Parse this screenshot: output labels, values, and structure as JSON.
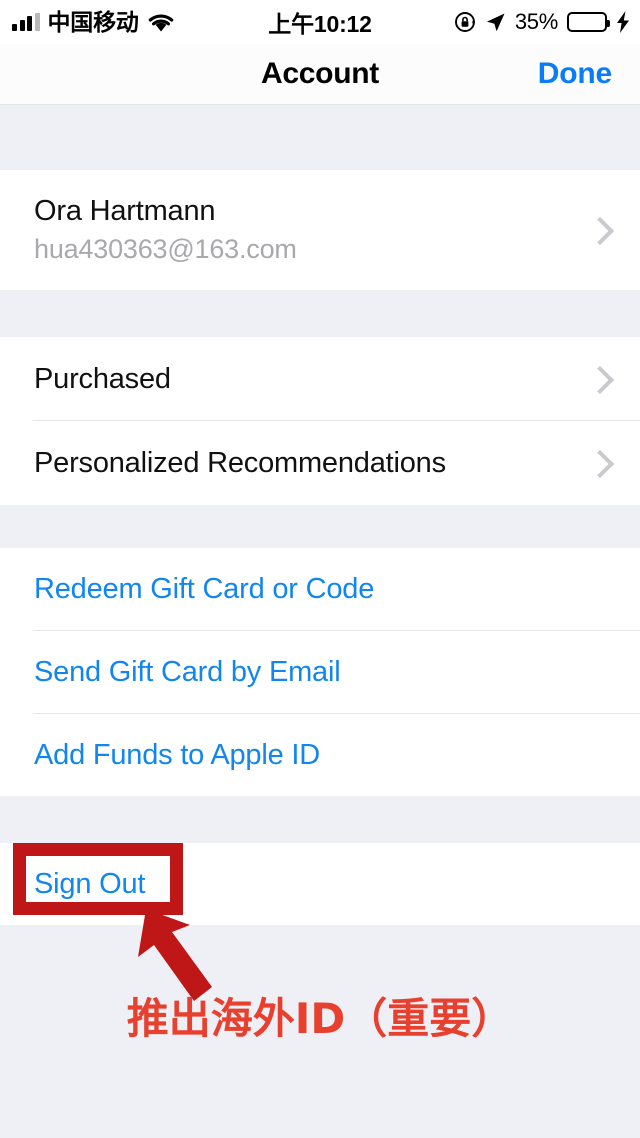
{
  "status_bar": {
    "carrier": "中国移动",
    "time": "上午10:12",
    "battery_percent": "35%",
    "battery_level": 35,
    "icons": {
      "signal": "signal-bars-icon",
      "wifi": "wifi-icon",
      "rotation_lock": "rotation-lock-icon",
      "location": "location-arrow-icon",
      "charging": "lightning-bolt-icon"
    }
  },
  "nav": {
    "title": "Account",
    "done_label": "Done"
  },
  "account": {
    "name": "Ora Hartmann",
    "email": "hua430363@163.com"
  },
  "sections": {
    "media": [
      {
        "label": "Purchased"
      },
      {
        "label": "Personalized Recommendations"
      }
    ],
    "gift": [
      {
        "label": "Redeem Gift Card or Code"
      },
      {
        "label": "Send Gift Card by Email"
      },
      {
        "label": "Add Funds to Apple ID"
      }
    ],
    "signout": {
      "label": "Sign Out"
    }
  },
  "annotation": {
    "caption": "推出海外ID（重要）",
    "highlight_target": "Sign Out",
    "color": "#bf1717",
    "text_color": "#e8402f"
  },
  "colors": {
    "accent_blue": "#1186ef",
    "nav_blue": "#0a7cf7",
    "background": "#eff0f5",
    "card": "#ffffff",
    "separator": "#e6e6e9",
    "subtext_gray": "#a8a8ad",
    "battery_green": "#3ad34b"
  }
}
